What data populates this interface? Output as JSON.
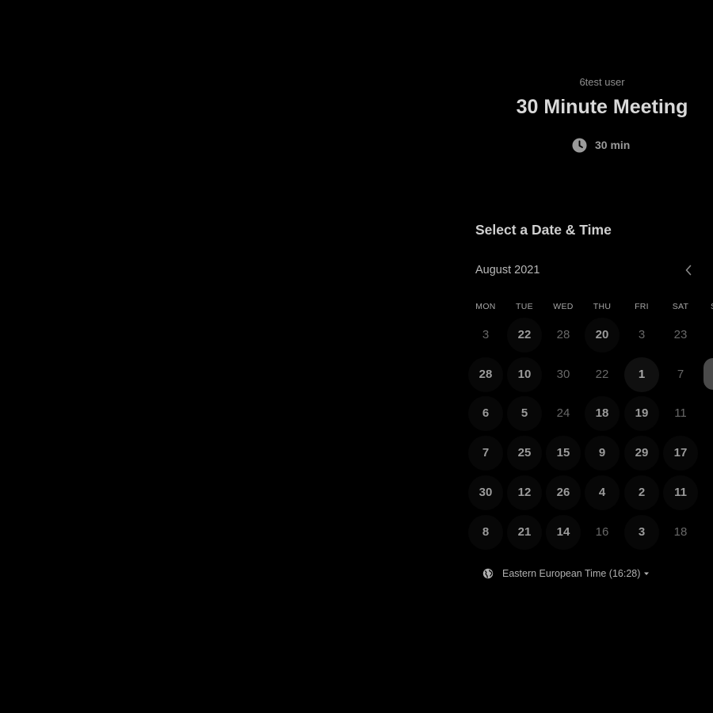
{
  "event": {
    "host": "6test user",
    "title": "30 Minute Meeting",
    "duration": "30 min"
  },
  "scheduler": {
    "section_title": "Select a Date & Time",
    "month": "August 2021",
    "prev_month_icon": "chevron-left-icon",
    "weekdays": [
      "MON",
      "TUE",
      "WED",
      "THU",
      "FRI",
      "SAT",
      "S"
    ],
    "weeks": [
      [
        {
          "label": "3",
          "available": false
        },
        {
          "label": "22",
          "available": true
        },
        {
          "label": "28",
          "available": false
        },
        {
          "label": "20",
          "available": true
        },
        {
          "label": "3",
          "available": false
        },
        {
          "label": "23",
          "available": false
        }
      ],
      [
        {
          "label": "28",
          "available": true
        },
        {
          "label": "10",
          "available": true
        },
        {
          "label": "30",
          "available": false
        },
        {
          "label": "22",
          "available": false
        },
        {
          "label": "1",
          "available": true,
          "highlight": true
        },
        {
          "label": "7",
          "available": false
        }
      ],
      [
        {
          "label": "6",
          "available": true
        },
        {
          "label": "5",
          "available": true
        },
        {
          "label": "24",
          "available": false
        },
        {
          "label": "18",
          "available": true
        },
        {
          "label": "19",
          "available": true
        },
        {
          "label": "11",
          "available": false
        }
      ],
      [
        {
          "label": "7",
          "available": true
        },
        {
          "label": "25",
          "available": true
        },
        {
          "label": "15",
          "available": true
        },
        {
          "label": "9",
          "available": true
        },
        {
          "label": "29",
          "available": true
        },
        {
          "label": "17",
          "available": true
        }
      ],
      [
        {
          "label": "30",
          "available": true
        },
        {
          "label": "12",
          "available": true
        },
        {
          "label": "26",
          "available": true
        },
        {
          "label": "4",
          "available": true
        },
        {
          "label": "2",
          "available": true
        },
        {
          "label": "11",
          "available": true
        }
      ],
      [
        {
          "label": "8",
          "available": true
        },
        {
          "label": "21",
          "available": true
        },
        {
          "label": "14",
          "available": true
        },
        {
          "label": "16",
          "available": false
        },
        {
          "label": "3",
          "available": true
        },
        {
          "label": "18",
          "available": false
        }
      ]
    ],
    "timezone": "Eastern European Time (16:28)"
  },
  "icons": {
    "duration": "clock-icon",
    "timezone": "globe-icon",
    "timezone_dropdown": "caret-down-icon"
  },
  "colors": {
    "background": "#000000",
    "title_text": "#d9d9d9",
    "available_day_bg": "#070707",
    "available_day_text": "#9b9b9b",
    "unavailable_day_text": "#686868"
  }
}
